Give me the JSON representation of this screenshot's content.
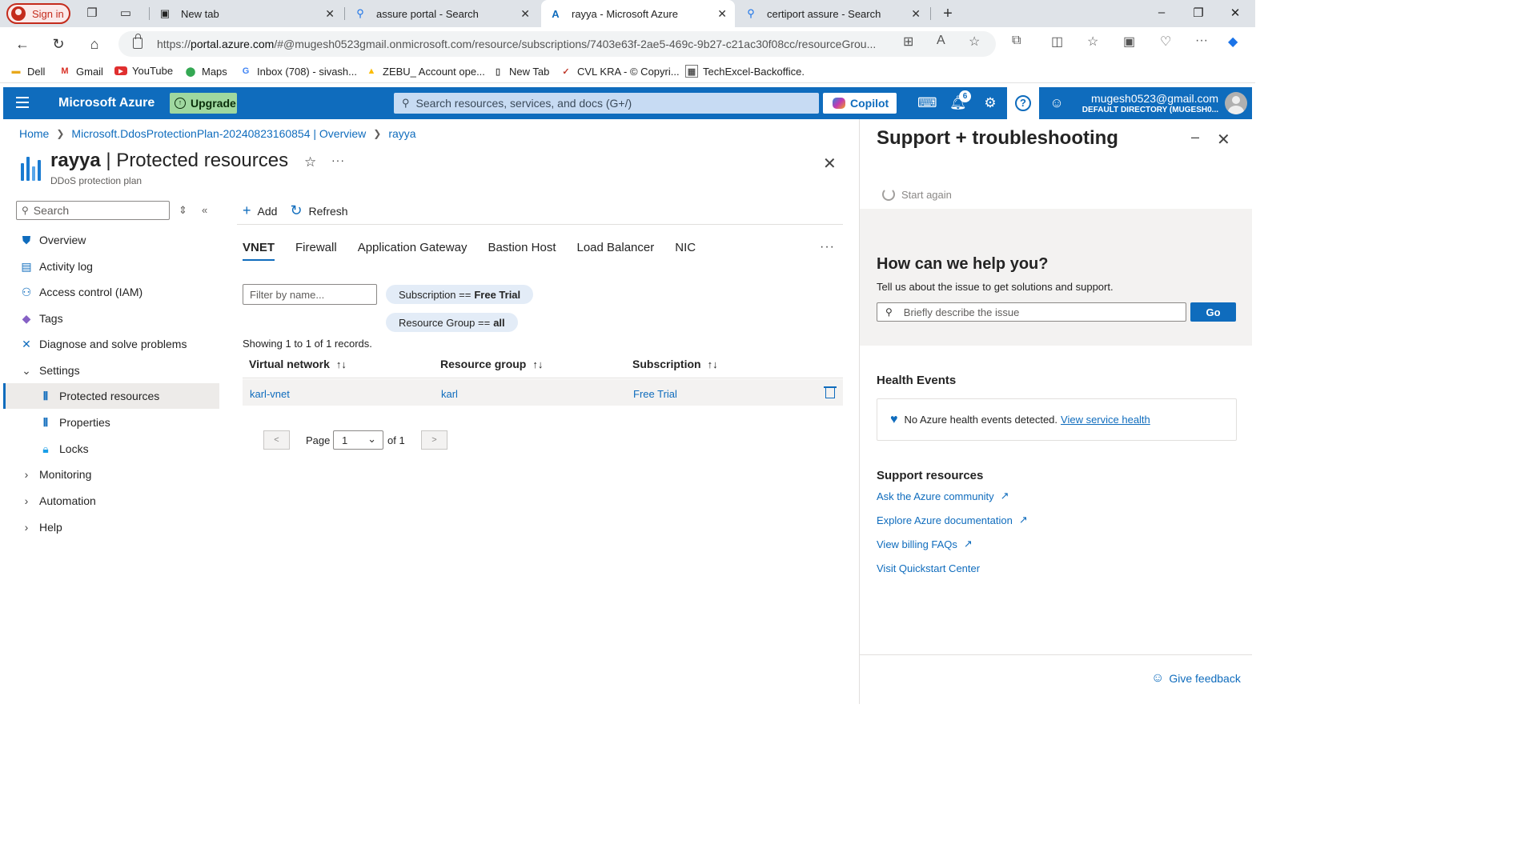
{
  "browser": {
    "signin_label": "Sign in",
    "tabs": [
      {
        "title": "New tab",
        "icon": "new-tab-icon"
      },
      {
        "title": "assure portal - Search",
        "icon": "search-icon"
      },
      {
        "title": "rayya - Microsoft Azure",
        "icon": "azure-icon"
      },
      {
        "title": "certiport assure - Search",
        "icon": "search-icon"
      }
    ],
    "url_prefix": "https://",
    "url_host": "portal.azure.com",
    "url_rest": "/#@mugesh0523gmail.onmicrosoft.com/resource/subscriptions/7403e63f-2ae5-469c-9b27-c21ac30f08cc/resourceGrou...",
    "bookmarks": [
      {
        "label": "Dell",
        "icon": "folder-icon"
      },
      {
        "label": "Gmail",
        "icon": "gmail-icon"
      },
      {
        "label": "YouTube",
        "icon": "youtube-icon"
      },
      {
        "label": "Maps",
        "icon": "maps-icon"
      },
      {
        "label": "Inbox (708) - sivash...",
        "icon": "google-icon"
      },
      {
        "label": "ZEBU_ Account ope...",
        "icon": "drive-icon"
      },
      {
        "label": "New Tab",
        "icon": "page-icon"
      },
      {
        "label": "CVL KRA - © Copyri...",
        "icon": "cvl-icon"
      },
      {
        "label": "TechExcel-Backoffice.",
        "icon": "techexcel-icon"
      }
    ]
  },
  "azure": {
    "brand": "Microsoft Azure",
    "upgrade_label": "Upgrade",
    "search_placeholder": "Search resources, services, and docs (G+/)",
    "copilot_label": "Copilot",
    "notification_count": "6",
    "account_email": "mugesh0523@gmail.com",
    "account_directory": "DEFAULT DIRECTORY (MUGESH0...",
    "accent_color": "#0f6cbd"
  },
  "breadcrumb": [
    "Home",
    "Microsoft.DdosProtectionPlan-20240823160854 | Overview",
    "rayya"
  ],
  "page": {
    "resource_name": "rayya",
    "blade_title": " | Protected resources",
    "subtitle": "DDoS protection plan"
  },
  "sidebar": {
    "search_placeholder": "Search",
    "items": [
      {
        "label": "Overview",
        "icon": "shield-icon"
      },
      {
        "label": "Activity log",
        "icon": "log-icon"
      },
      {
        "label": "Access control (IAM)",
        "icon": "people-icon"
      },
      {
        "label": "Tags",
        "icon": "tag-icon"
      },
      {
        "label": "Diagnose and solve problems",
        "icon": "wrench-icon"
      },
      {
        "label": "Settings",
        "icon": "chevron-down-icon"
      },
      {
        "label": "Protected resources",
        "icon": "bars-icon"
      },
      {
        "label": "Properties",
        "icon": "bars-icon"
      },
      {
        "label": "Locks",
        "icon": "lock-icon"
      },
      {
        "label": "Monitoring",
        "icon": "chevron-right-icon"
      },
      {
        "label": "Automation",
        "icon": "chevron-right-icon"
      },
      {
        "label": "Help",
        "icon": "chevron-right-icon"
      }
    ]
  },
  "toolbar": {
    "add_label": "Add",
    "refresh_label": "Refresh"
  },
  "tabs": [
    "VNET",
    "Firewall",
    "Application Gateway",
    "Bastion Host",
    "Load Balancer",
    "NIC"
  ],
  "filters": {
    "name_placeholder": "Filter by name...",
    "subscription_label": "Subscription ==",
    "subscription_value": "Free Trial",
    "rg_label": "Resource Group ==",
    "rg_value": "all"
  },
  "records_text": "Showing 1 to 1 of 1 records.",
  "table": {
    "columns": [
      "Virtual network",
      "Resource group",
      "Subscription"
    ],
    "rows": [
      {
        "vnet": "karl-vnet",
        "rg": "karl",
        "subscription": "Free Trial"
      }
    ]
  },
  "pagination": {
    "prev": "<",
    "next": ">",
    "page_label": "Page",
    "page_value": "1",
    "of_label": "of 1"
  },
  "support": {
    "title": "Support + troubleshooting",
    "start_again": "Start again",
    "help_heading": "How can we help you?",
    "help_sub": "Tell us about the issue to get solutions and support.",
    "help_placeholder": "Briefly describe the issue",
    "go_label": "Go",
    "health_heading": "Health Events",
    "health_text": "No Azure health events detected.",
    "health_link": "View service health",
    "resources_heading": "Support resources",
    "links": [
      {
        "label": "Ask the Azure community",
        "external": true
      },
      {
        "label": "Explore Azure documentation",
        "external": true
      },
      {
        "label": "View billing FAQs",
        "external": true
      },
      {
        "label": "Visit Quickstart Center",
        "external": false
      }
    ],
    "feedback_label": "Give feedback"
  }
}
